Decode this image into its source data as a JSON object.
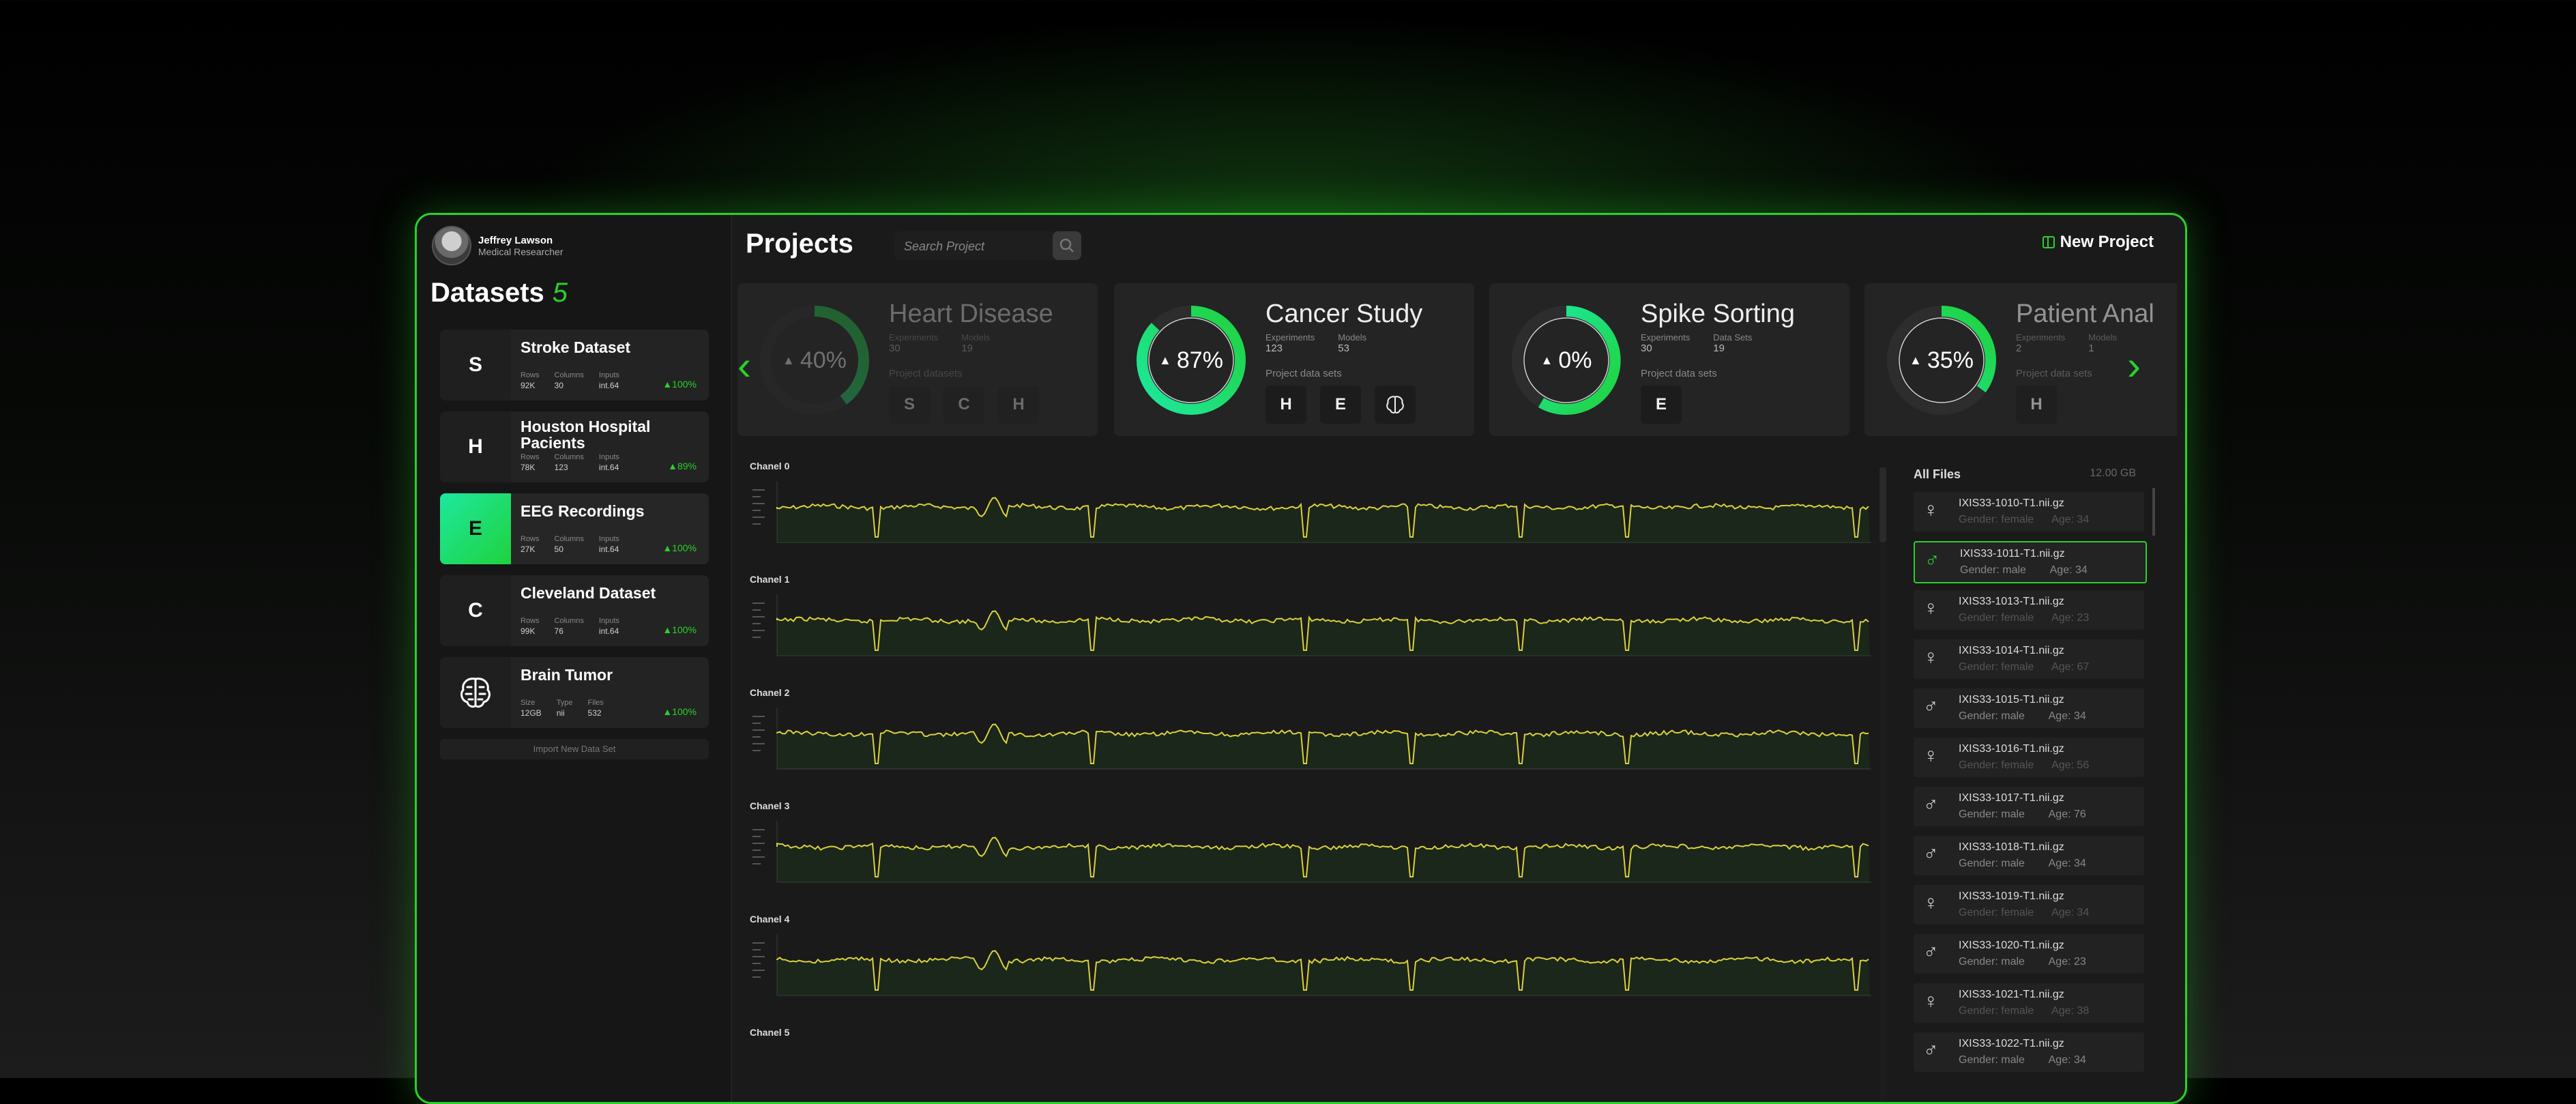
{
  "user": {
    "name": "Jeffrey Lawson",
    "role": "Medical Researcher"
  },
  "datasets": {
    "title": "Datasets",
    "count": "5",
    "items": [
      {
        "icon": "S",
        "name": "Stroke Dataset",
        "m1_label": "Rows",
        "m1_value": "92K",
        "m2_label": "Columns",
        "m2_value": "30",
        "m3_label": "Inputs",
        "m3_value": "int.64",
        "pct": "▲100%"
      },
      {
        "icon": "H",
        "name": "Houston Hospital Pacients",
        "m1_label": "Rows",
        "m1_value": "78K",
        "m2_label": "Columns",
        "m2_value": "123",
        "m3_label": "Inputs",
        "m3_value": "int.64",
        "pct": "▲89%"
      },
      {
        "icon": "E",
        "name": "EEG Recordings",
        "m1_label": "Rows",
        "m1_value": "27K",
        "m2_label": "Columns",
        "m2_value": "50",
        "m3_label": "Inputs",
        "m3_value": "int.64",
        "pct": "▲100%"
      },
      {
        "icon": "C",
        "name": "Cleveland Dataset",
        "m1_label": "Rows",
        "m1_value": "99K",
        "m2_label": "Columns",
        "m2_value": "76",
        "m3_label": "Inputs",
        "m3_value": "int.64",
        "pct": "▲100%"
      },
      {
        "icon": "brain-icon",
        "name": "Brain Tumor",
        "m1_label": "Size",
        "m1_value": "12GB",
        "m2_label": "Type",
        "m2_value": "nii",
        "m3_label": "Files",
        "m3_value": "532",
        "pct": "▲100%"
      }
    ],
    "import_label": "Import New Data Set"
  },
  "header": {
    "title": "Projects",
    "search_placeholder": "Search Project",
    "new_project_label": "New Project"
  },
  "projects": [
    {
      "name": "Heart Disease",
      "percent": "40%",
      "progress": 0.4,
      "s1_label": "Experiments",
      "s1_value": "30",
      "s2_label": "Models",
      "s2_value": "19",
      "sub": "Project datasets",
      "badges": [
        "S",
        "C",
        "H"
      ]
    },
    {
      "name": "Cancer Study",
      "percent": "87%",
      "progress": 0.87,
      "s1_label": "Experiments",
      "s1_value": "123",
      "s2_label": "Models",
      "s2_value": "53",
      "sub": "Project data sets",
      "badges": [
        "H",
        "E",
        "brain"
      ]
    },
    {
      "name": "Spike Sorting",
      "percent": "0%",
      "progress": 0.0,
      "s1_label": "Experiments",
      "s1_value": "30",
      "s2_label": "Data Sets",
      "s2_value": "19",
      "sub": "Project data sets",
      "badges": [
        "E"
      ]
    },
    {
      "name": "Patient Anal",
      "percent": "35%",
      "progress": 0.35,
      "s1_label": "Experiments",
      "s1_value": "2",
      "s2_label": "Models",
      "s2_value": "1",
      "sub": "Project data sets",
      "badges": [
        "H"
      ]
    }
  ],
  "channels": [
    "Chanel 0",
    "Chanel 1",
    "Chanel 2",
    "Chanel 3",
    "Chanel 4",
    "Chanel 5"
  ],
  "files": {
    "title": "All Files",
    "size": "12.00 GB",
    "items": [
      {
        "name": "IXIS33-1010-T1.nii.gz",
        "gender": "female",
        "age": "34",
        "info": "Gender: female      Age: 34"
      },
      {
        "name": "IXIS33-1011-T1.nii.gz",
        "gender": "male",
        "age": "34",
        "info": "Gender: male        Age: 34"
      },
      {
        "name": "IXIS33-1013-T1.nii.gz",
        "gender": "female",
        "age": "23",
        "info": "Gender: female      Age: 23"
      },
      {
        "name": "IXIS33-1014-T1.nii.gz",
        "gender": "female",
        "age": "67",
        "info": "Gender: female      Age: 67"
      },
      {
        "name": "IXIS33-1015-T1.nii.gz",
        "gender": "male",
        "age": "34",
        "info": "Gender: male        Age: 34"
      },
      {
        "name": "IXIS33-1016-T1.nii.gz",
        "gender": "female",
        "age": "56",
        "info": "Gender: female      Age: 56"
      },
      {
        "name": "IXIS33-1017-T1.nii.gz",
        "gender": "male",
        "age": "76",
        "info": "Gender: male        Age: 76"
      },
      {
        "name": "IXIS33-1018-T1.nii.gz",
        "gender": "male",
        "age": "34",
        "info": "Gender: male        Age: 34"
      },
      {
        "name": "IXIS33-1019-T1.nii.gz",
        "gender": "female",
        "age": "34",
        "info": "Gender: female      Age: 34"
      },
      {
        "name": "IXIS33-1020-T1.nii.gz",
        "gender": "male",
        "age": "23",
        "info": "Gender: male        Age: 23"
      },
      {
        "name": "IXIS33-1021-T1.nii.gz",
        "gender": "female",
        "age": "38",
        "info": "Gender: female      Age: 38"
      },
      {
        "name": "IXIS33-1022-T1.nii.gz",
        "gender": "male",
        "age": "34",
        "info": "Gender: male        Age: 34"
      }
    ]
  },
  "colors": {
    "accent": "#2ad12a",
    "accent_teal": "#1ee8a0",
    "signal_yellow": "#d8d23a"
  }
}
